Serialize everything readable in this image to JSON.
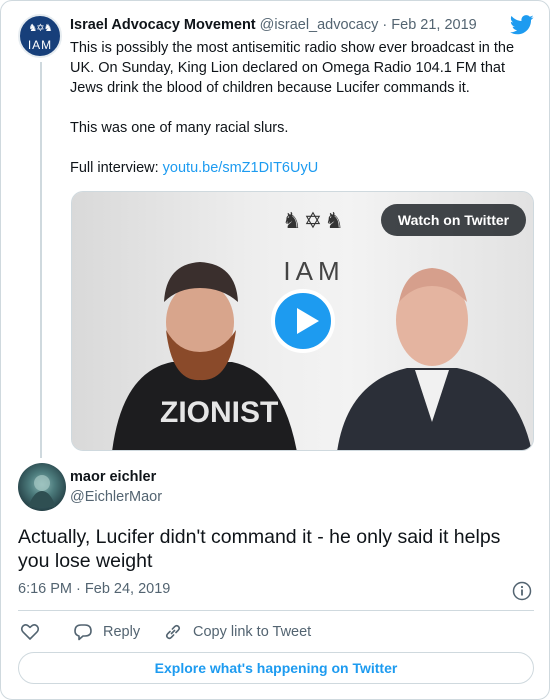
{
  "parent_tweet": {
    "avatar_icon": "iam-logo-icon",
    "avatar_label": "IAM",
    "name": "Israel Advocacy Movement",
    "handle": "@israel_advocacy",
    "separator": "·",
    "date": "Feb 21, 2019",
    "platform_icon": "twitter-bird-icon",
    "text_line1": "This is possibly the most antisemitic radio show ever broadcast in the UK. On Sunday, King Lion declared on Omega Radio 104.1 FM that Jews drink the blood of children because Lucifer commands it.",
    "text_line2": "This was one of many racial slurs.",
    "interview_prefix": "Full interview: ",
    "interview_link": "youtu.be/smZ1DIT6UyU",
    "video": {
      "watch_label": "Watch on Twitter",
      "play_icon": "play-icon",
      "backdrop_text": "IAM",
      "shirt_text": "ZIONIST"
    }
  },
  "reply_tweet": {
    "name": "maor eichler",
    "handle": "@EichlerMaor",
    "text": "Actually, Lucifer didn't command it - he only said it helps you lose weight",
    "time": "6:16 PM",
    "separator": "·",
    "date": "Feb 24, 2019",
    "info_icon": "info-icon"
  },
  "actions": {
    "like_icon": "heart-icon",
    "reply_label": "Reply",
    "reply_icon": "reply-icon",
    "copy_label": "Copy link to Tweet",
    "copy_icon": "link-icon"
  },
  "footer": {
    "explore_label": "Explore what's happening on Twitter"
  },
  "colors": {
    "accent": "#1d9bf0",
    "text": "#0f1419",
    "secondary": "#536471",
    "border": "#cfd9de"
  }
}
